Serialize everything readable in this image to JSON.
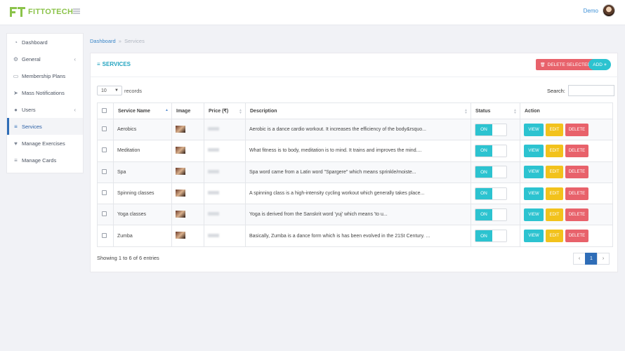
{
  "brand": {
    "name": "FITTOTECH",
    "accent": "#8bc34a"
  },
  "user": {
    "name": "Demo"
  },
  "sidebar": {
    "items": [
      {
        "label": "Dashboard",
        "icon": "dashboard-icon",
        "glyph": "◔",
        "chevron": false
      },
      {
        "label": "General",
        "icon": "cogs-icon",
        "glyph": "⚙",
        "chevron": true
      },
      {
        "label": "Membership Plans",
        "icon": "plan-card-icon",
        "glyph": "▭",
        "chevron": false
      },
      {
        "label": "Mass Notifications",
        "icon": "paper-plane-icon",
        "glyph": "➤",
        "chevron": false
      },
      {
        "label": "Users",
        "icon": "user-icon",
        "glyph": "●",
        "chevron": true
      },
      {
        "label": "Services",
        "icon": "list-icon",
        "glyph": "≡",
        "chevron": false,
        "active": true
      },
      {
        "label": "Manage Exercises",
        "icon": "heartbeat-icon",
        "glyph": "♥",
        "chevron": false
      },
      {
        "label": "Manage Cards",
        "icon": "list-icon",
        "glyph": "≡",
        "chevron": false
      }
    ],
    "chevron_glyph": "‹"
  },
  "breadcrumb": {
    "root": "Dashboard",
    "separator": "»",
    "current": "Services"
  },
  "page": {
    "title": "SERVICES",
    "title_glyph": "≡",
    "delete_selected": "DELETE SELECTED",
    "delete_glyph": "🗑",
    "add": "ADD",
    "add_glyph": "+"
  },
  "controls": {
    "length_value": "10",
    "records_label": "records",
    "search_label": "Search:",
    "search_value": ""
  },
  "table": {
    "headers": [
      "",
      "Service Name",
      "Image",
      "Price (₹)",
      "Description",
      "Status",
      "Action"
    ],
    "toggle_on": "ON",
    "actions": {
      "view": "VIEW",
      "edit": "EDIT",
      "delete": "DELETE"
    },
    "rows": [
      {
        "name": "Aerobics",
        "description": "Aerobic is a dance cardio workout. It increases the efficiency of the body&rsquo...",
        "status": "ON"
      },
      {
        "name": "Meditation",
        "description": "What fitness is to body, meditation is to mind. It trains and improves the mind....",
        "status": "ON"
      },
      {
        "name": "Spa",
        "description": "Spa word came from a Latin word \"Spargere\" which means sprinkle/moiste...",
        "status": "ON"
      },
      {
        "name": "Spinning classes",
        "description": "A spinning class is a high-intensity cycling workout which generally takes place...",
        "status": "ON"
      },
      {
        "name": "Yoga classes",
        "description": "Yoga is derived from the Sanskrit word 'yuj' which means 'to u...",
        "status": "ON"
      },
      {
        "name": "Zumba",
        "description": "Basically, Zumba is a dance form which is has been evolved in the 21St Century. ...",
        "status": "ON"
      }
    ]
  },
  "footer": {
    "info": "Showing 1 to 6 of 6 entries",
    "prev": "‹",
    "page": "1",
    "next": "›"
  },
  "colors": {
    "primary": "#2cc3d0",
    "danger": "#e8626b",
    "warning": "#f2c21c",
    "active": "#2f6db7"
  }
}
